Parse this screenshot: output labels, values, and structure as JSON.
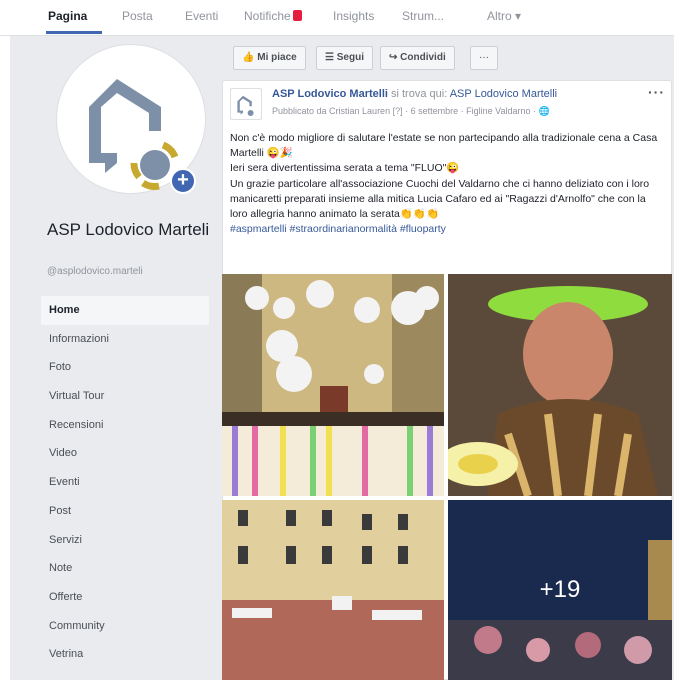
{
  "tabs": [
    {
      "label": "Pagina"
    },
    {
      "label": "Posta"
    },
    {
      "label": "Eventi"
    },
    {
      "label": "Notifiche"
    },
    {
      "label": "Insights"
    },
    {
      "label": "Strum..."
    },
    {
      "label": "Altro ▾"
    }
  ],
  "page": {
    "name": "ASP Lodovico Marteli",
    "handle": "@asplodovico.marteli"
  },
  "nav": [
    {
      "label": "Home"
    },
    {
      "label": "Informazioni"
    },
    {
      "label": "Foto"
    },
    {
      "label": "Virtual Tour"
    },
    {
      "label": "Recensioni"
    },
    {
      "label": "Video"
    },
    {
      "label": "Eventi"
    },
    {
      "label": "Post"
    },
    {
      "label": "Servizi"
    },
    {
      "label": "Note"
    },
    {
      "label": "Offerte"
    },
    {
      "label": "Community"
    },
    {
      "label": "Vetrina"
    }
  ],
  "actions": {
    "like": "Mi piace",
    "follow": "Segui",
    "share": "Condividi",
    "more": "···"
  },
  "post": {
    "author": "ASP Lodovico Martelli",
    "location_prefix": "si trova qui:",
    "location": "ASP Lodovico Martelli",
    "meta": "Pubblicato da Cristian Lauren [?] · 6 settembre · Figline Valdarno ·",
    "more": "···",
    "text_lines": [
      "Non c'è modo migliore di salutare l'estate se non partecipando alla tradizionale cena a Casa Martelli 😜🎉",
      "Ieri sera divertentissima serata a tema \"FLUO\"😜",
      "Un grazie particolare all'associazione Cuochi del Valdarno che ci hanno deliziato con i loro manicaretti preparati insieme alla mitica Lucia Cafaro ed ai \"Ragazzi d'Arnolfo\" che con la loro allegria hanno animato la serata👏👏👏"
    ],
    "hashtags": "#aspmartelli #straordinarianormalità #fluoparty",
    "extra_photos": "+19"
  },
  "colors": {
    "brand": "#4267b2",
    "link": "#365899",
    "background": "#e9ebee"
  }
}
